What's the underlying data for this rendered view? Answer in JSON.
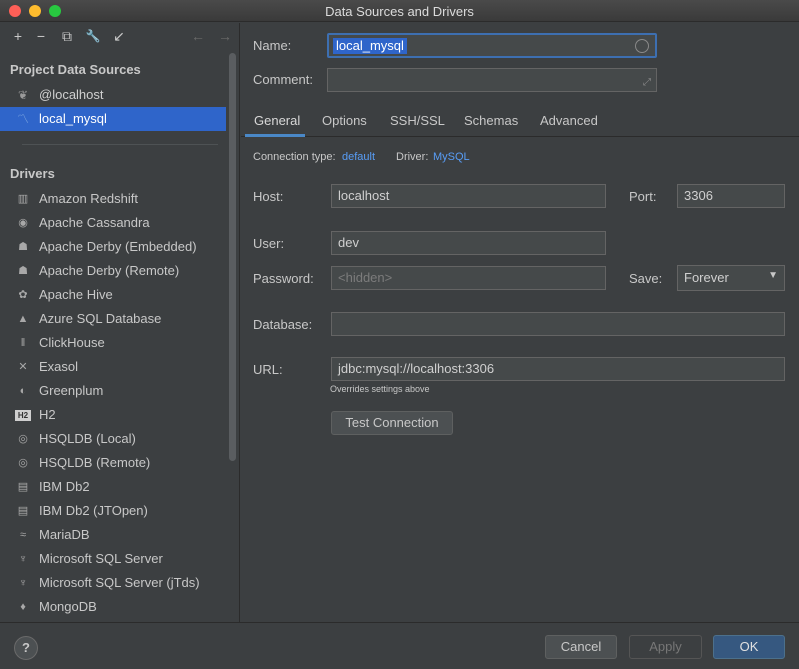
{
  "window": {
    "title": "Data Sources and Drivers"
  },
  "toolbar": {
    "add_icon": "+",
    "remove_icon": "−",
    "copy_icon": "⧉",
    "wrench_icon": "🔧",
    "import_icon": "↙",
    "back_icon": "←",
    "forward_icon": "→"
  },
  "sidebar": {
    "project_title": "Project Data Sources",
    "data_sources": [
      {
        "label": "@localhost",
        "icon": "leaf-icon",
        "selected": false
      },
      {
        "label": "local_mysql",
        "icon": "dolphin-icon",
        "selected": true
      }
    ],
    "drivers_title": "Drivers",
    "drivers": [
      {
        "label": "Amazon Redshift",
        "icon": "redshift-icon",
        "glyph": "▥"
      },
      {
        "label": "Apache Cassandra",
        "icon": "cassandra-icon",
        "glyph": "◉"
      },
      {
        "label": "Apache Derby (Embedded)",
        "icon": "derby-icon",
        "glyph": "☗"
      },
      {
        "label": "Apache Derby (Remote)",
        "icon": "derby-icon",
        "glyph": "☗"
      },
      {
        "label": "Apache Hive",
        "icon": "hive-icon",
        "glyph": "✿"
      },
      {
        "label": "Azure SQL Database",
        "icon": "azure-icon",
        "glyph": "▲"
      },
      {
        "label": "ClickHouse",
        "icon": "clickhouse-icon",
        "glyph": "‖"
      },
      {
        "label": "Exasol",
        "icon": "exasol-icon",
        "glyph": "✕"
      },
      {
        "label": "Greenplum",
        "icon": "greenplum-icon",
        "glyph": "◐"
      },
      {
        "label": "H2",
        "icon": "h2-icon",
        "glyph": "H2"
      },
      {
        "label": "HSQLDB (Local)",
        "icon": "hsqldb-icon",
        "glyph": "◎"
      },
      {
        "label": "HSQLDB (Remote)",
        "icon": "hsqldb-icon",
        "glyph": "◎"
      },
      {
        "label": "IBM Db2",
        "icon": "ibm-db2-icon",
        "glyph": "▤"
      },
      {
        "label": "IBM Db2 (JTOpen)",
        "icon": "ibm-db2-icon",
        "glyph": "▤"
      },
      {
        "label": "MariaDB",
        "icon": "mariadb-icon",
        "glyph": "≈"
      },
      {
        "label": "Microsoft SQL Server",
        "icon": "sqlserver-icon",
        "glyph": "♆"
      },
      {
        "label": "Microsoft SQL Server (jTds)",
        "icon": "sqlserver-icon",
        "glyph": "♆"
      },
      {
        "label": "MongoDB",
        "icon": "mongodb-icon",
        "glyph": "♦"
      }
    ]
  },
  "form": {
    "name_label": "Name:",
    "name_value": "local_mysql",
    "comment_label": "Comment:",
    "comment_value": "",
    "expand_icon": "⤢",
    "tabs": [
      "General",
      "Options",
      "SSH/SSL",
      "Schemas",
      "Advanced"
    ],
    "connection_type_label": "Connection type:",
    "connection_type_value": "default",
    "driver_label": "Driver:",
    "driver_value": "MySQL",
    "host_label": "Host:",
    "host_value": "localhost",
    "port_label": "Port:",
    "port_value": "3306",
    "user_label": "User:",
    "user_value": "dev",
    "password_label": "Password:",
    "password_placeholder": "<hidden>",
    "save_label": "Save:",
    "save_value": "Forever",
    "database_label": "Database:",
    "database_value": "",
    "url_label": "URL:",
    "url_value": "jdbc:mysql://localhost:3306",
    "url_hint": "Overrides settings above",
    "test_connection": "Test Connection"
  },
  "footer": {
    "help": "?",
    "cancel": "Cancel",
    "apply": "Apply",
    "ok": "OK"
  }
}
